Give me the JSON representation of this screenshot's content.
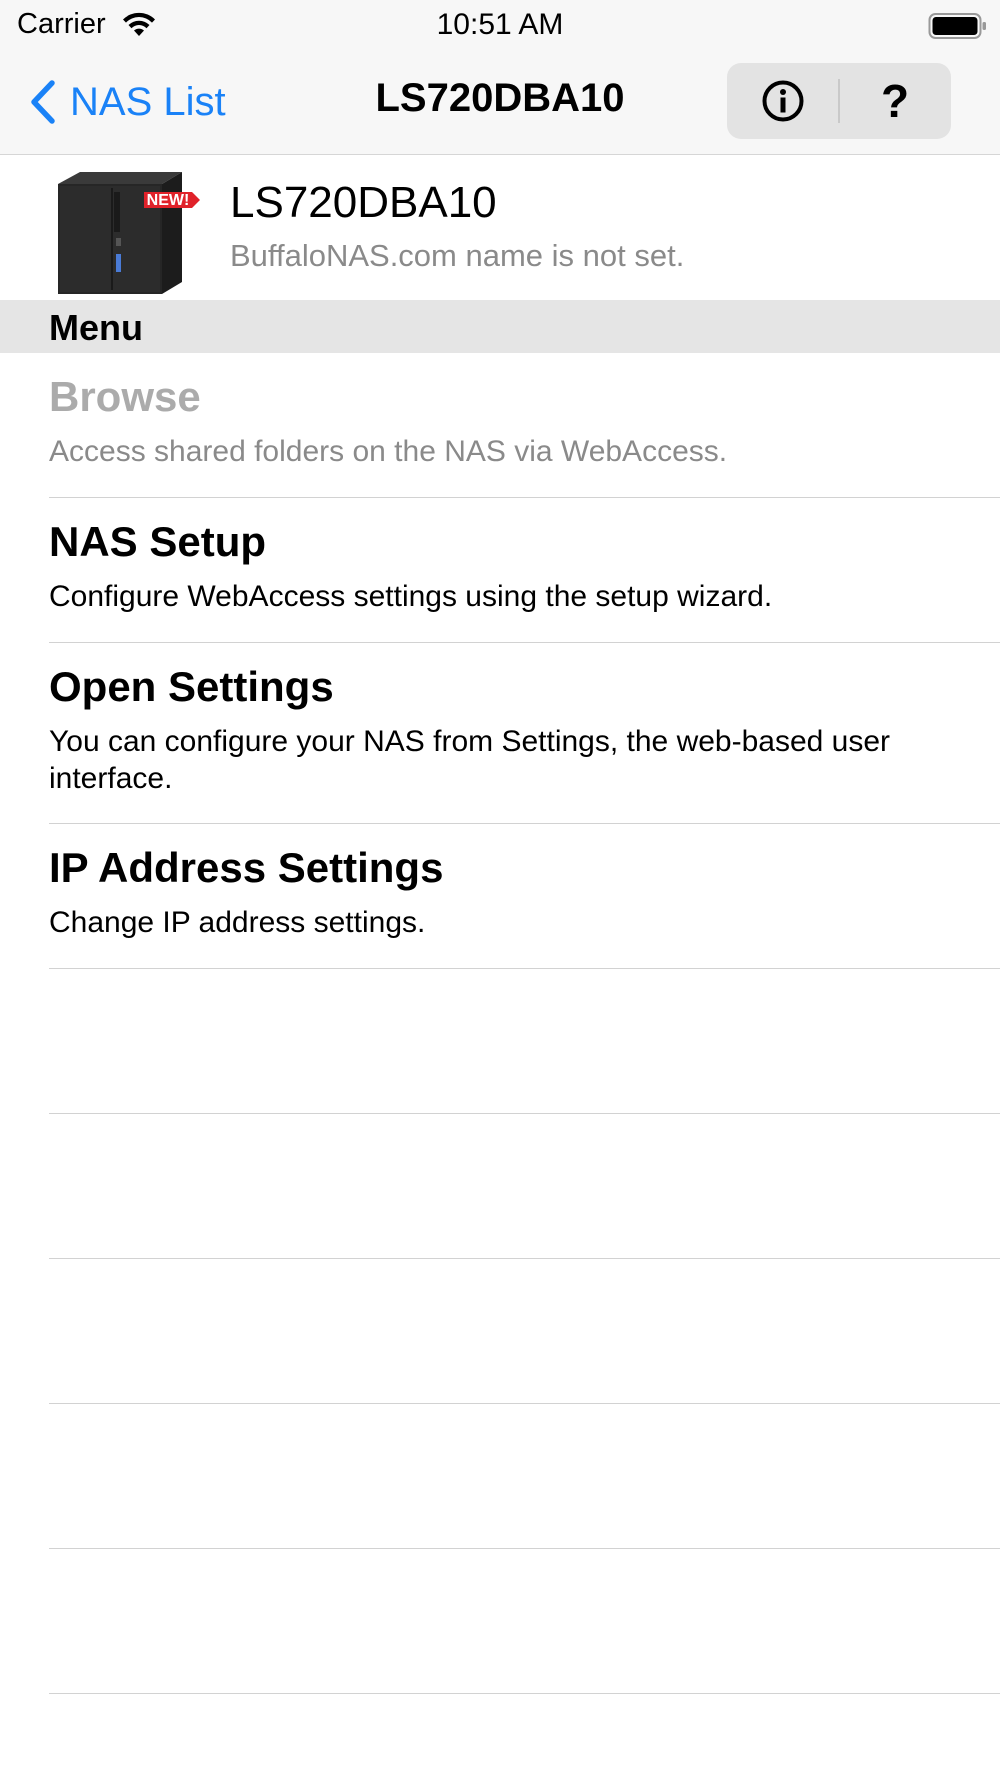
{
  "status_bar": {
    "carrier": "Carrier",
    "time": "10:51 AM",
    "wifi_icon": "wifi-icon",
    "battery_icon": "battery-full-icon"
  },
  "nav_bar": {
    "back_label": "NAS List",
    "title": "LS720DBA10",
    "info_icon": "info-circle-icon",
    "help_label": "?",
    "accent_color": "#1a82f7"
  },
  "device": {
    "name": "LS720DBA10",
    "subtitle": "BuffaloNAS.com name is not set.",
    "badge": "NEW!",
    "badge_color": "#e0222a"
  },
  "menu": {
    "section_title": "Menu",
    "items": [
      {
        "title": "Browse",
        "description": "Access shared folders on the NAS via WebAccess.",
        "enabled": false
      },
      {
        "title": "NAS Setup",
        "description": "Configure WebAccess settings using the setup wizard.",
        "enabled": true
      },
      {
        "title": "Open Settings",
        "description": "You can configure your NAS from Settings, the web-based user interface.",
        "enabled": true
      },
      {
        "title": "IP Address Settings",
        "description": "Change IP address settings.",
        "enabled": true
      }
    ]
  }
}
